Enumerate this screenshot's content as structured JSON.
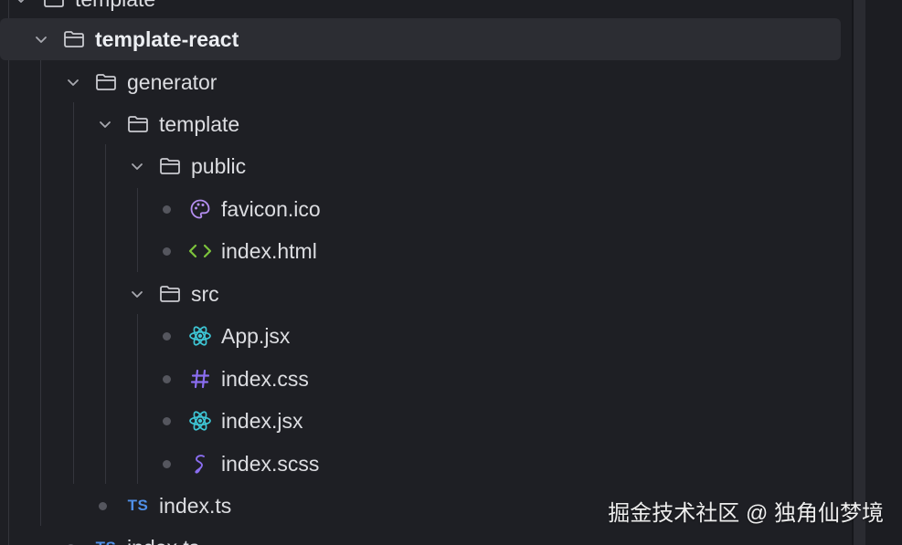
{
  "explorer": {
    "items": [
      {
        "label": "template"
      },
      {
        "label": "template-react"
      },
      {
        "label": "generator"
      },
      {
        "label": "template"
      },
      {
        "label": "public"
      },
      {
        "label": "favicon.ico"
      },
      {
        "label": "index.html"
      },
      {
        "label": "src"
      },
      {
        "label": "App.jsx"
      },
      {
        "label": "index.css"
      },
      {
        "label": "index.jsx"
      },
      {
        "label": "index.scss"
      },
      {
        "label": "index.ts",
        "badge": "TS"
      },
      {
        "label": "index.ts",
        "badge": "TS"
      }
    ]
  },
  "watermark": "掘金技术社区 @ 独角仙梦境",
  "colors": {
    "background": "#1e1f24",
    "selected_row": "#2c2d33",
    "react_icon": "#3ec7d6",
    "css_icon": "#8a6df0",
    "html_icon": "#7cc33c",
    "ts_badge": "#4f8fe8",
    "favicon_icon": "#b48ef0"
  }
}
